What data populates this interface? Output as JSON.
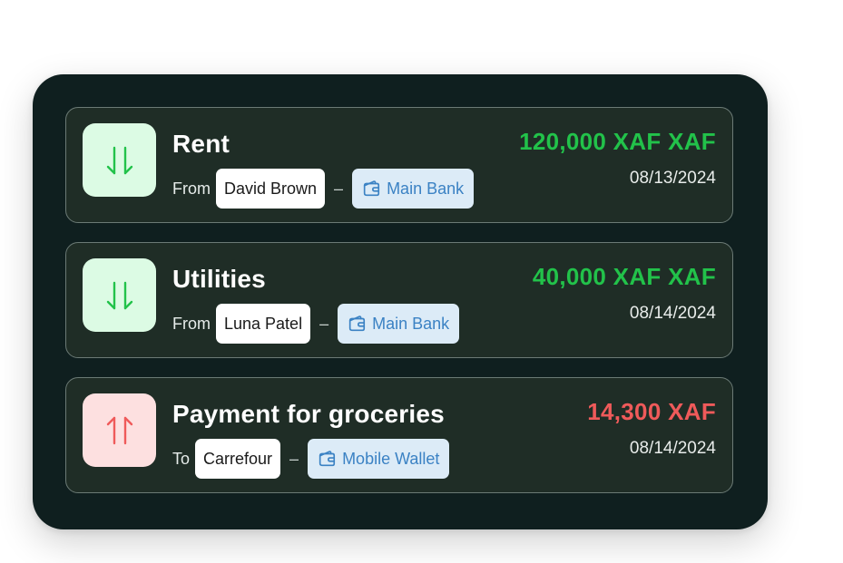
{
  "transactions": [
    {
      "title": "Rent",
      "direction": "in",
      "direction_word": "From",
      "party": "David Brown",
      "separator": "–",
      "account": "Main Bank",
      "account_icon": "wallet-icon",
      "amount": "120,000 XAF XAF",
      "date": "08/13/2024"
    },
    {
      "title": "Utilities",
      "direction": "in",
      "direction_word": "From",
      "party": "Luna Patel",
      "separator": "–",
      "account": "Main Bank",
      "account_icon": "wallet-icon",
      "amount": "40,000 XAF XAF",
      "date": "08/14/2024"
    },
    {
      "title": "Payment for groceries",
      "direction": "out",
      "direction_word": "To",
      "party": "Carrefour",
      "separator": "–",
      "account": "Mobile Wallet",
      "account_icon": "wallet-icon",
      "amount": "14,300 XAF",
      "date": "08/14/2024"
    }
  ],
  "colors": {
    "panel_bg": "#0f1f1f",
    "card_bg": "#1f2d26",
    "income_green": "#22c24a",
    "expense_red": "#ef5a5a",
    "account_blue": "#3b82c4"
  },
  "icons": {
    "incoming": "arrows-down-up-icon",
    "outgoing": "arrows-up-down-icon"
  }
}
